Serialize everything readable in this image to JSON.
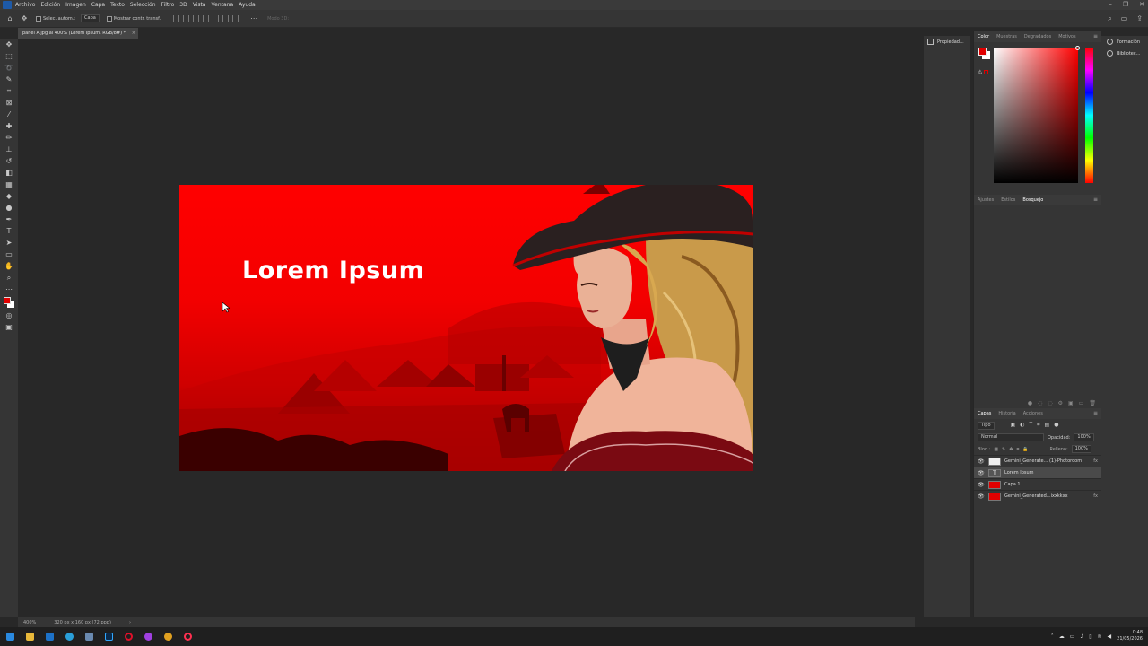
{
  "menubar": {
    "items": [
      "Archivo",
      "Edición",
      "Imagen",
      "Capa",
      "Texto",
      "Selección",
      "Filtro",
      "3D",
      "Vista",
      "Ventana",
      "Ayuda"
    ]
  },
  "options": {
    "auto_select_label": "Selec. autom.:",
    "auto_select_value": "Capa",
    "show_transform_label": "Mostrar contr. transf.",
    "mode3d_label": "Modo 3D:"
  },
  "document": {
    "tab_title": "panel A.jpg al 400% (Lorem Ipsum, RGB/8#) *",
    "zoom": "400%",
    "size_info": "320 px x 160 px (72 ppp)",
    "artwork_title": "Lorem Ipsum"
  },
  "panels": {
    "properties_label": "Propiedad...",
    "learn_label": "Formación",
    "libraries_label": "Bibliotec...",
    "color_tabs": [
      "Color",
      "Muestras",
      "Degradados",
      "Motivos"
    ],
    "color_active": "Color",
    "adjust_tabs": [
      "Ajustes",
      "Estilos",
      "Bosquejo"
    ],
    "adjust_active": "Bosquejo",
    "layers_tabs": [
      "Capas",
      "Historia",
      "Acciones"
    ],
    "layers_active": "Capas",
    "filter_kind": "Tipo",
    "blend_mode": "Normal",
    "opacity_label": "Opacidad:",
    "opacity_value": "100%",
    "lock_label": "Bloq.:",
    "fill_label": "Relleno:",
    "fill_value": "100%",
    "fg_color": "#e00000",
    "bg_color": "#ffffff"
  },
  "layers": [
    {
      "name": "Gemini_Generate... (1)-Photoroom",
      "thumb": "t-white",
      "fx": true,
      "selected": false
    },
    {
      "name": "Lorem Ipsum",
      "thumb": "t-text",
      "fx": false,
      "selected": true
    },
    {
      "name": "Capa 1",
      "thumb": "t-red",
      "fx": false,
      "selected": false
    },
    {
      "name": "Gemini_Generated...ixxkkxx",
      "thumb": "t-red",
      "fx": true,
      "selected": false
    }
  ],
  "taskbar": {
    "time": "0:48",
    "date": "21/05/2026"
  }
}
